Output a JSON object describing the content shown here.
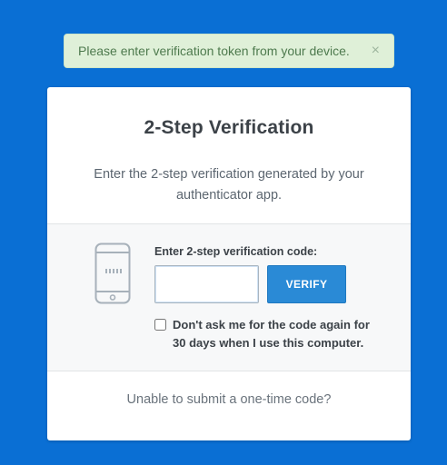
{
  "alert": {
    "message": "Please enter verification token from your device.",
    "close_label": "×"
  },
  "card": {
    "title": "2-Step Verification",
    "subtitle": "Enter the 2-step verification generated by your authenticator app.",
    "code_label": "Enter 2-step verification code:",
    "code_value": "",
    "verify_label": "VERIFY",
    "remember_label": "Don't ask me for the code again for 30 days when I use this computer.",
    "remember_checked": false,
    "footer_link": "Unable to submit a one-time code?"
  },
  "colors": {
    "background": "#0a6fd4",
    "alert_bg": "#dff0d8",
    "button": "#2a8ad6"
  }
}
